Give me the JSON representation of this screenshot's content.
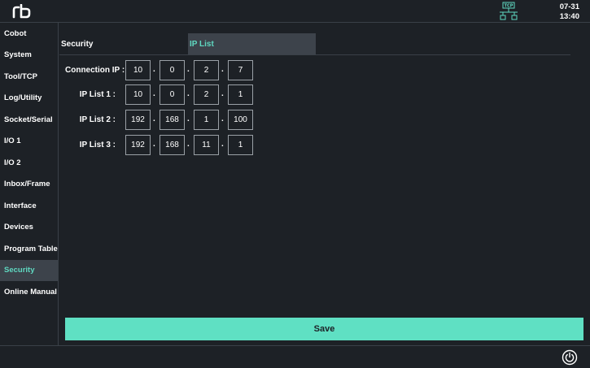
{
  "clock": {
    "date": "07-31",
    "time": "13:40"
  },
  "sidebar": {
    "items": [
      {
        "label": "Cobot"
      },
      {
        "label": "System"
      },
      {
        "label": "Tool/TCP"
      },
      {
        "label": "Log/Utility"
      },
      {
        "label": "Socket/Serial"
      },
      {
        "label": "I/O 1"
      },
      {
        "label": "I/O 2"
      },
      {
        "label": "Inbox/Frame"
      },
      {
        "label": "Interface"
      },
      {
        "label": "Devices"
      },
      {
        "label": "Program Table"
      },
      {
        "label": "Security"
      },
      {
        "label": "Online Manual"
      }
    ],
    "active_index": 11
  },
  "tabs": [
    {
      "label": "Security"
    },
    {
      "label": "IP List"
    }
  ],
  "ip_rows": [
    {
      "label": "Connection IP :",
      "octets": [
        "10",
        "0",
        "2",
        "7"
      ]
    },
    {
      "label": "IP List 1 :",
      "octets": [
        "10",
        "0",
        "2",
        "1"
      ]
    },
    {
      "label": "IP List 2 :",
      "octets": [
        "192",
        "168",
        "1",
        "100"
      ]
    },
    {
      "label": "IP List 3 :",
      "octets": [
        "192",
        "168",
        "11",
        "1"
      ]
    }
  ],
  "separator": ".",
  "save_label": "Save",
  "colors": {
    "accent": "#5fd9c1",
    "save_button": "#5fe0c3",
    "background": "#1d2126"
  },
  "icons": {
    "logo": "rb-logo",
    "network": "tcp-network-icon",
    "power": "power-icon"
  }
}
